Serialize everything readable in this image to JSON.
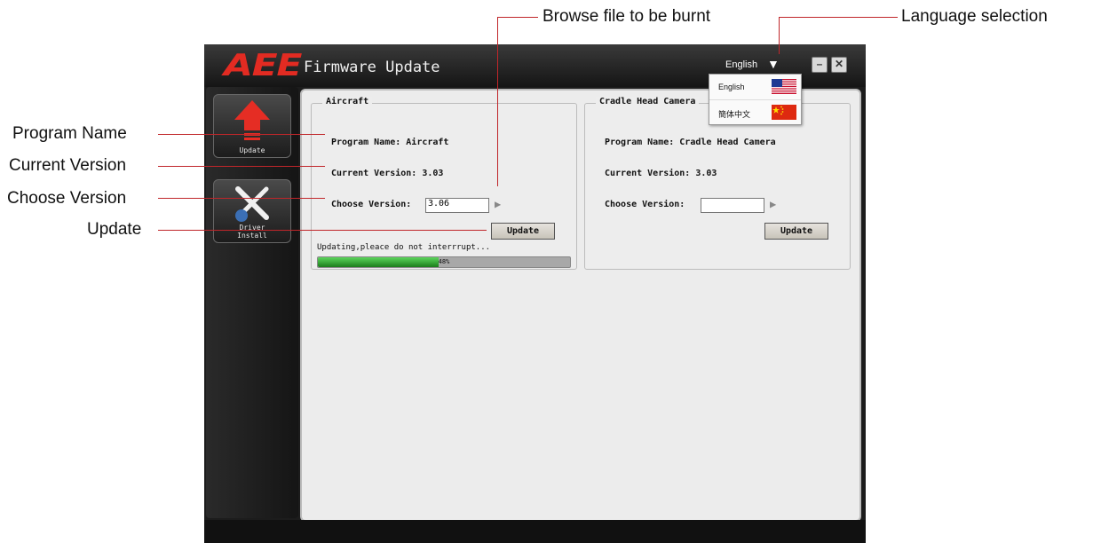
{
  "annotations": {
    "browse": "Browse file to be burnt",
    "language": "Language selection",
    "program_name": "Program Name",
    "current_version": "Current Version",
    "choose_version": "Choose Version",
    "update": "Update"
  },
  "app": {
    "logo": "AEE",
    "title": "Firmware Update",
    "language_current": "English",
    "minimize_label": "–",
    "close_label": "✕"
  },
  "language_menu": {
    "items": [
      {
        "label": "English",
        "flag": "us-flag"
      },
      {
        "label": "簡体中文",
        "flag": "cn-flag"
      }
    ]
  },
  "sidebar": {
    "items": [
      {
        "label": "Update",
        "icon": "upload-arrow-icon"
      },
      {
        "label": "Driver\nInstall",
        "icon": "tools-icon"
      }
    ]
  },
  "panels": {
    "aircraft": {
      "title": "Aircraft",
      "program_name": "Program Name: Aircraft",
      "current_version": "Current Version: 3.03",
      "choose_label": "Choose Version:",
      "choose_value": "3.06",
      "update_label": "Update",
      "status": "Updating,pleace do not interrrupt...",
      "progress": 48,
      "progress_label": "48%"
    },
    "camera": {
      "title": "Cradle Head Camera",
      "program_name": "Program Name: Cradle Head Camera",
      "current_version": "Current Version: 3.03",
      "choose_label": "Choose Version:",
      "choose_value": "",
      "update_label": "Update"
    }
  },
  "colors": {
    "accent": "#e22b22",
    "callout_line": "#c0262a",
    "progress_fill": "#2fa22f"
  }
}
